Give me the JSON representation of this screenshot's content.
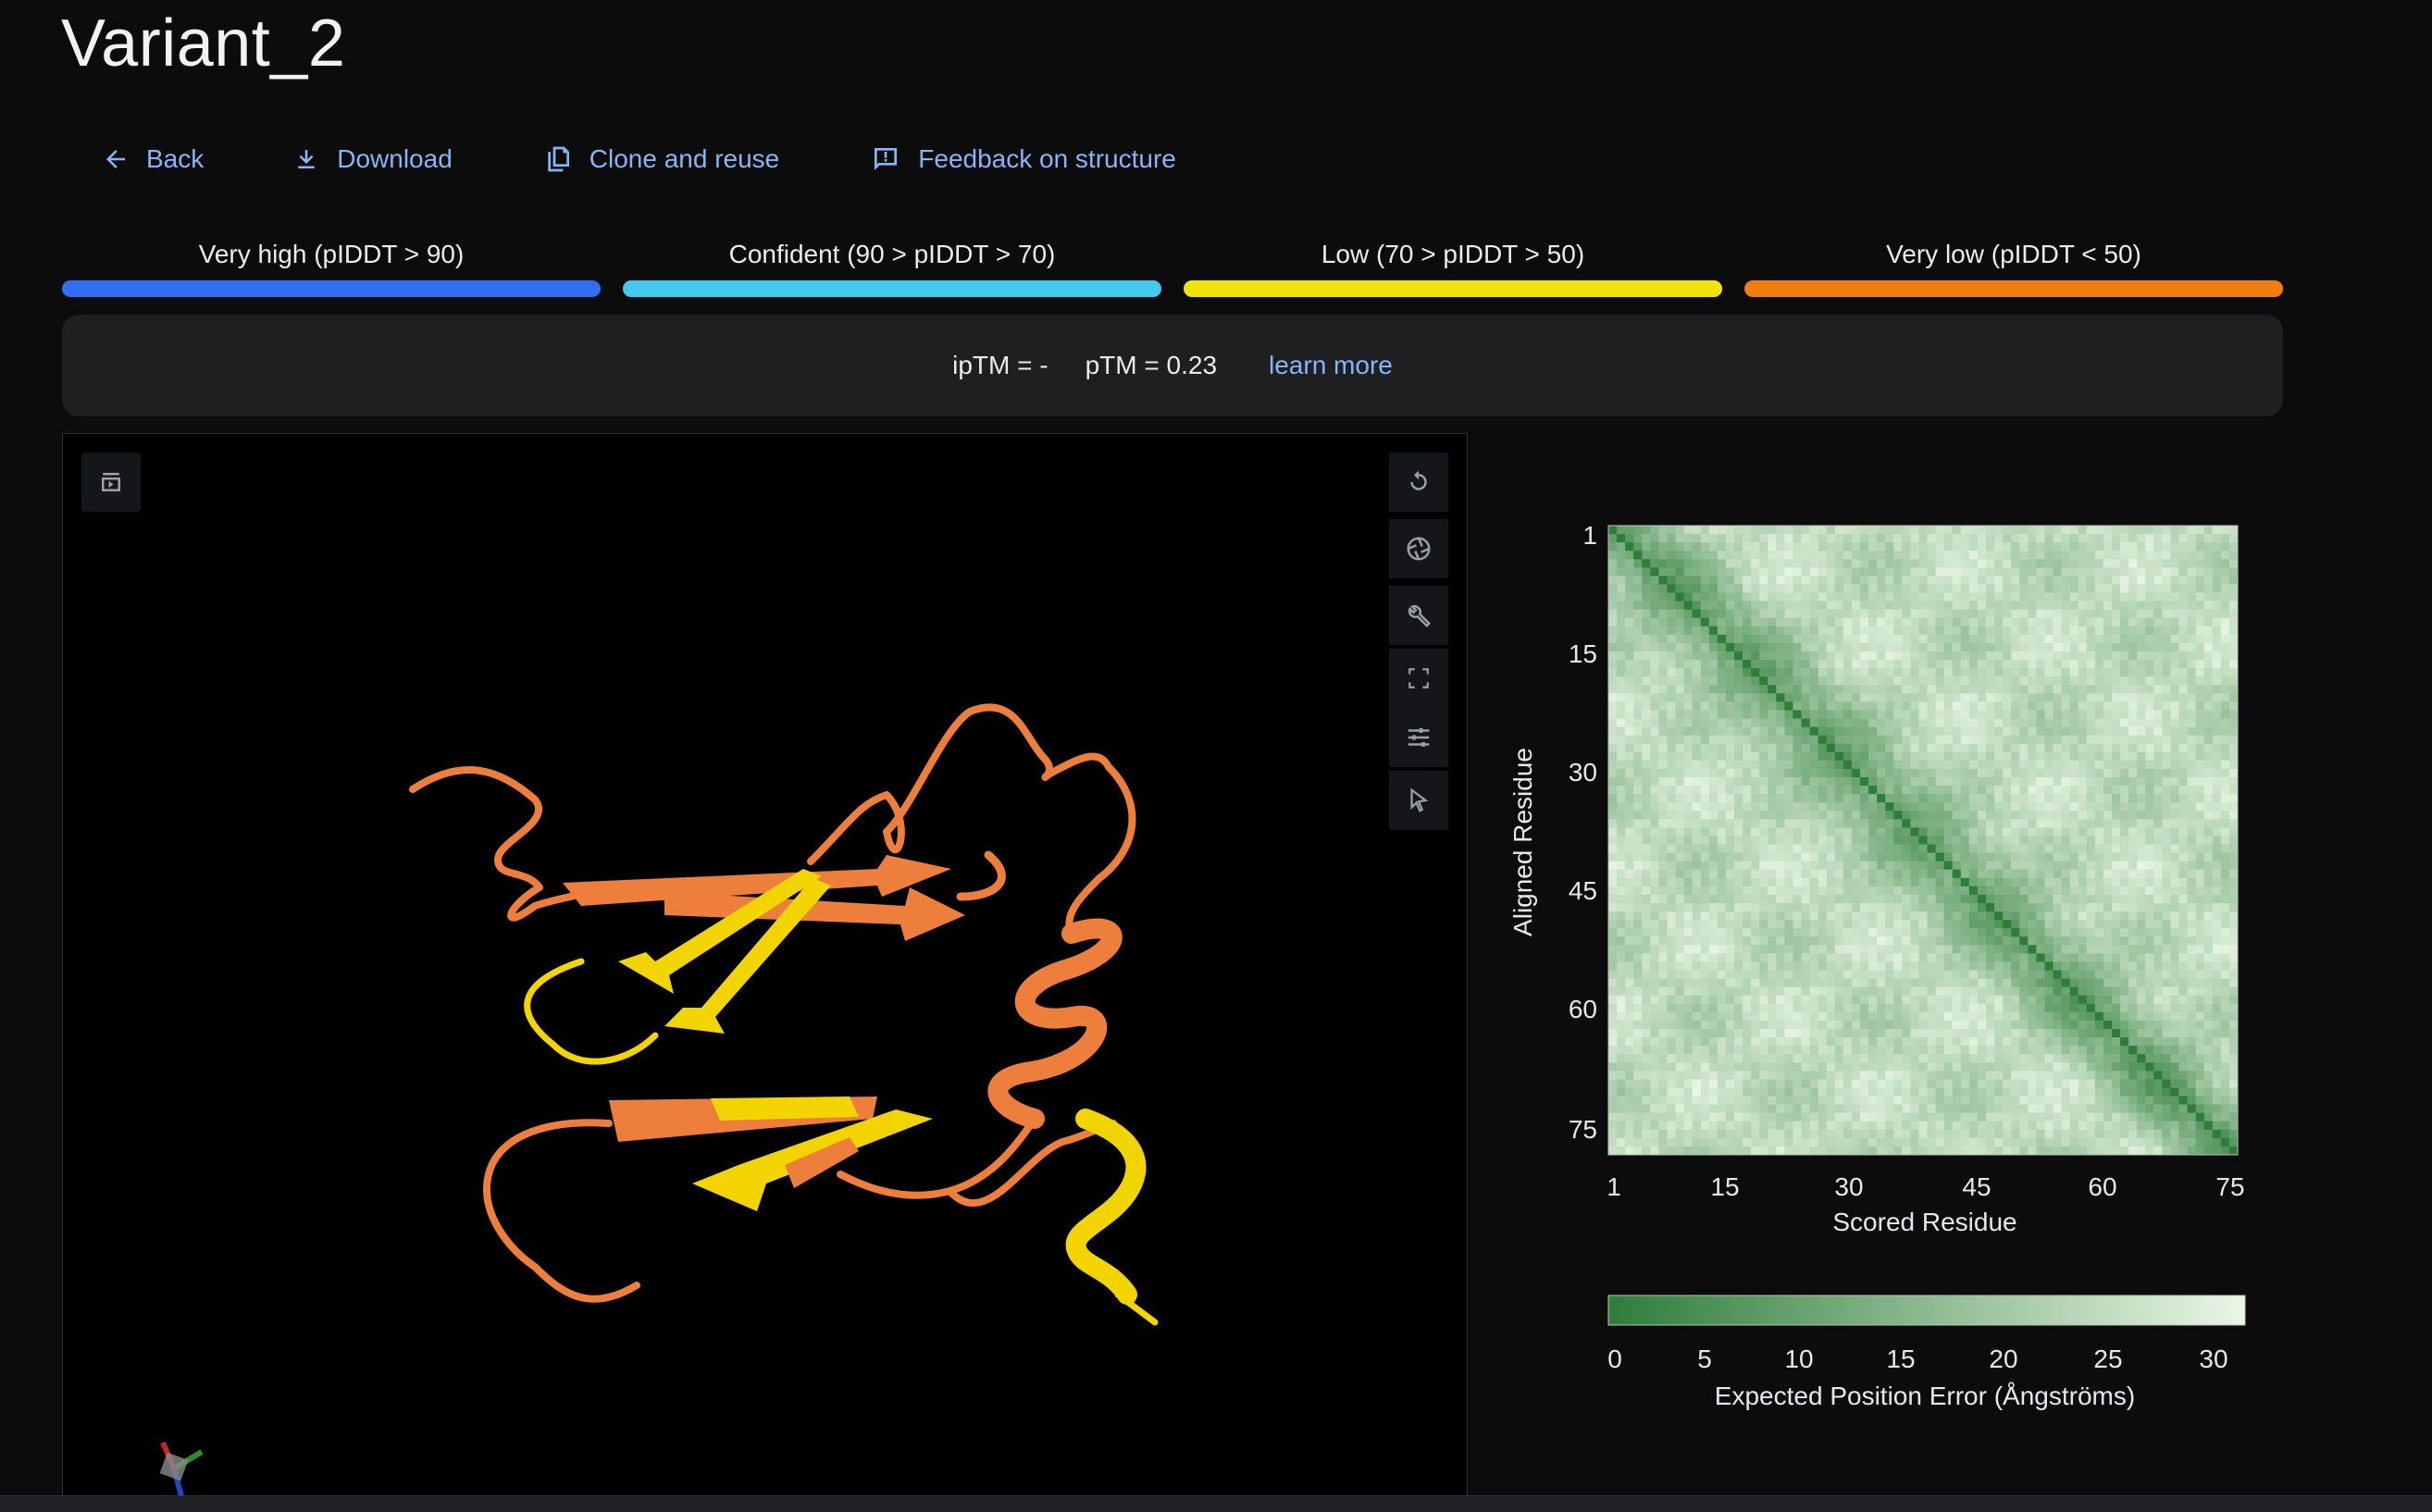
{
  "title": "Variant_2",
  "actions": {
    "back": "Back",
    "download": "Download",
    "clone": "Clone and reuse",
    "feedback": "Feedback on structure"
  },
  "plddt_legend": [
    {
      "label": "Very high (pIDDT > 90)",
      "color": "#2f6ff0"
    },
    {
      "label": "Confident (90 > pIDDT > 70)",
      "color": "#45c8ee"
    },
    {
      "label": "Low (70 > pIDDT > 50)",
      "color": "#f4e20c"
    },
    {
      "label": "Very low (pIDDT < 50)",
      "color": "#ee7e10"
    }
  ],
  "metrics": {
    "iptm": "ipTM = -",
    "ptm": "pTM = 0.23",
    "learn_more": "learn more"
  },
  "pae_plot": {
    "x_label": "Scored Residue",
    "y_label": "Aligned Residue",
    "ticks": [
      "1",
      "15",
      "30",
      "45",
      "60",
      "75"
    ],
    "colorbar_ticks": [
      "0",
      "5",
      "10",
      "15",
      "20",
      "25",
      "30"
    ],
    "colorbar_label": "Expected Position Error (Ångströms)",
    "colors": {
      "low": "#2f7d3a",
      "high": "#eaf7e6"
    }
  },
  "structure_colors": {
    "very_low": "#ee7e3c",
    "low": "#f2d400"
  }
}
